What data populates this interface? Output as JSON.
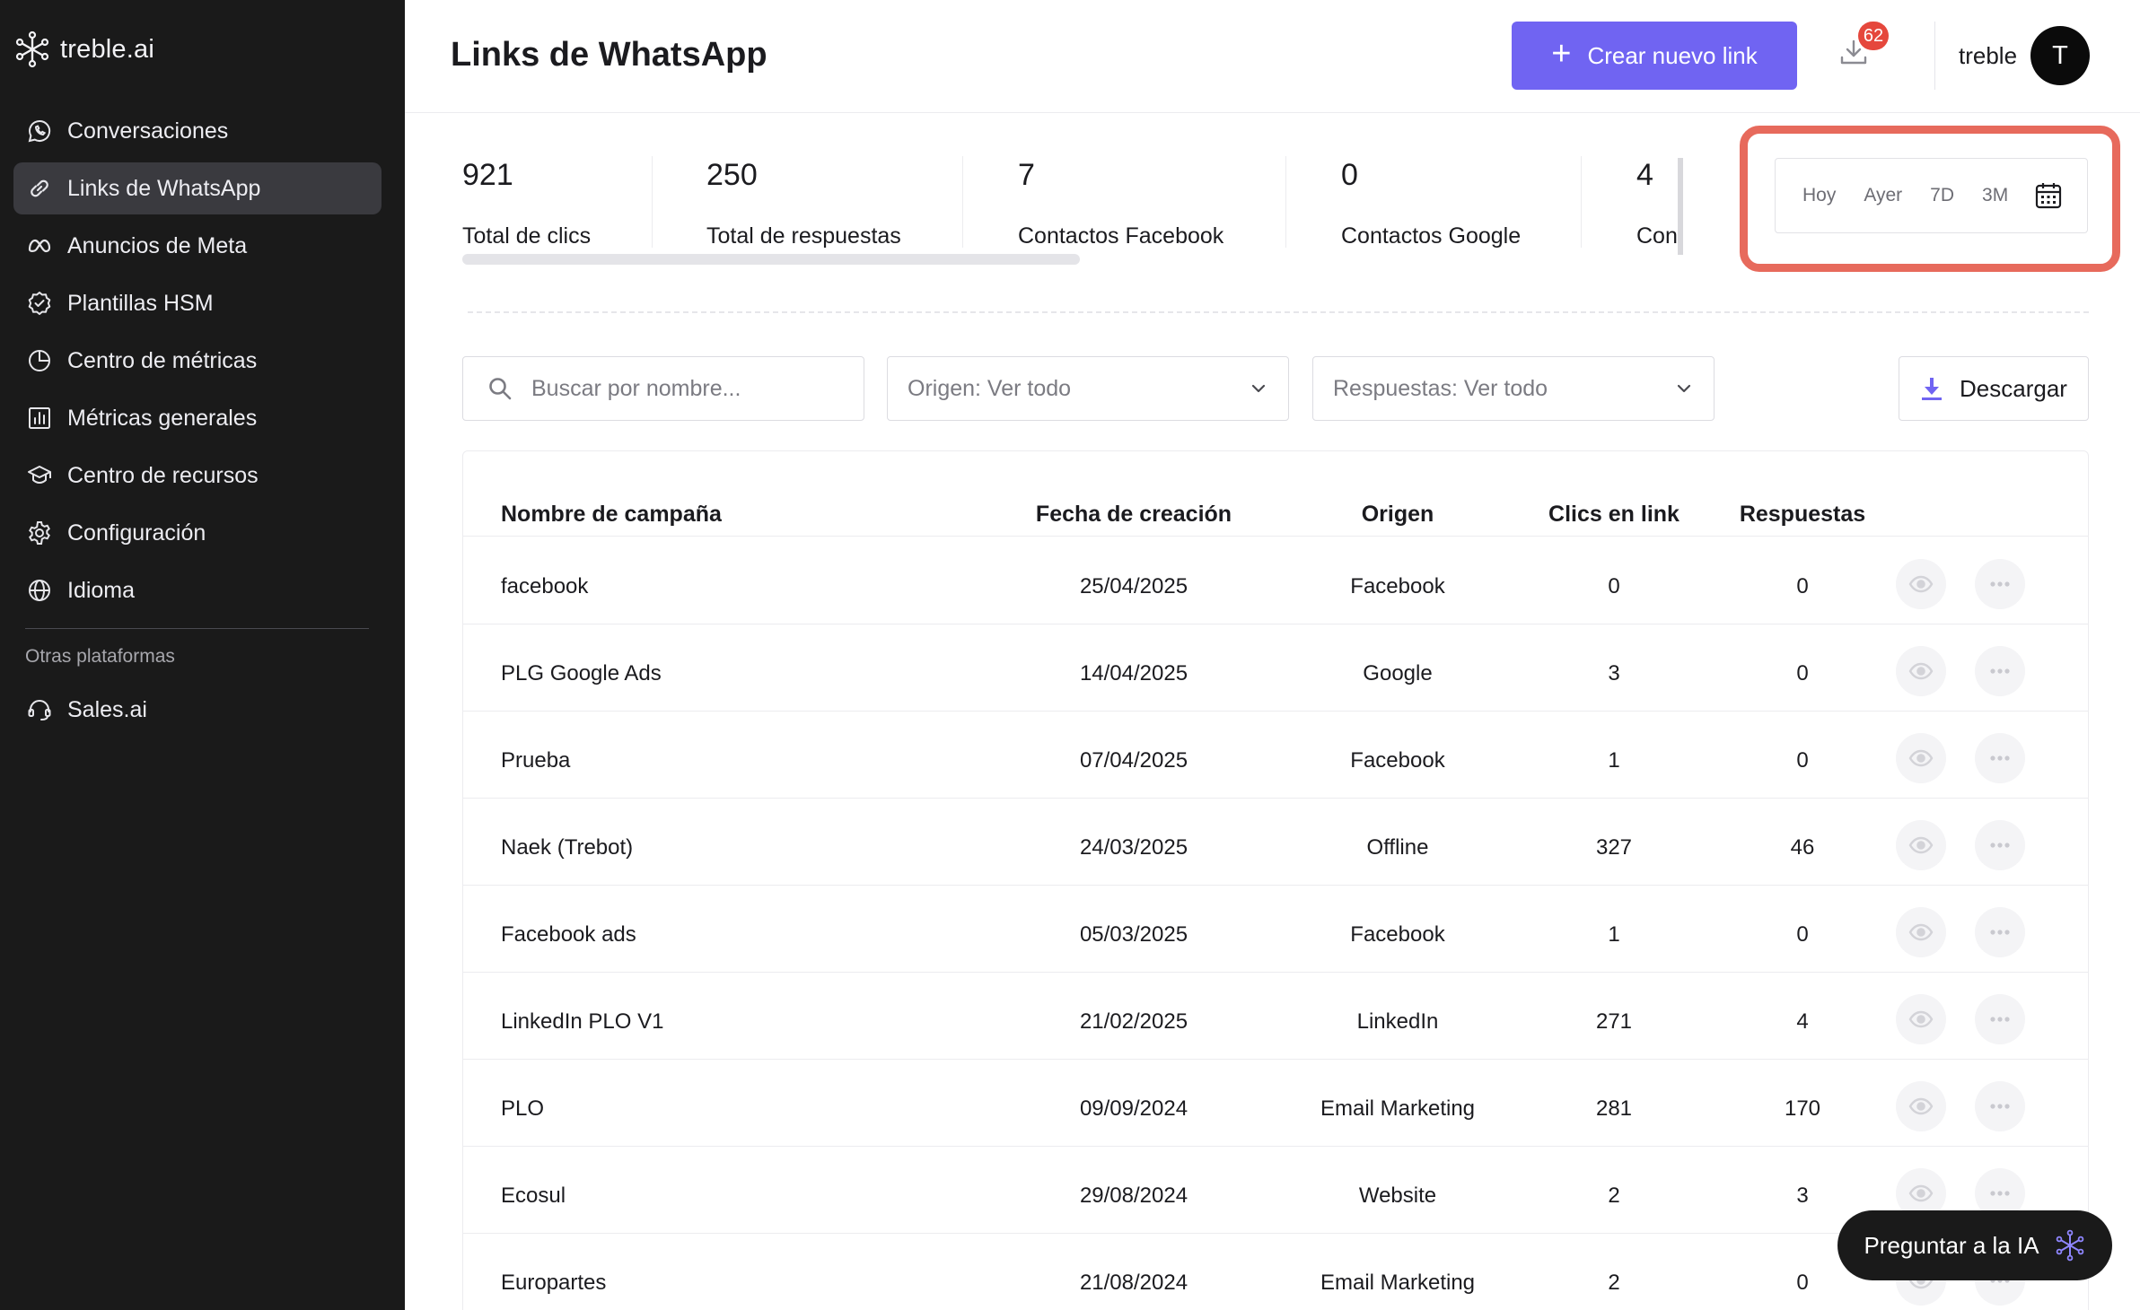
{
  "brand": {
    "name": "treble.ai"
  },
  "sidebar": {
    "items": [
      {
        "label": "Conversaciones",
        "icon": "whatsapp-icon",
        "active": false
      },
      {
        "label": "Links de WhatsApp",
        "icon": "link-icon",
        "active": true
      },
      {
        "label": "Anuncios de Meta",
        "icon": "meta-icon",
        "active": false
      },
      {
        "label": "Plantillas HSM",
        "icon": "badge-check-icon",
        "active": false
      },
      {
        "label": "Centro de métricas",
        "icon": "pie-chart-icon",
        "active": false
      },
      {
        "label": "Métricas generales",
        "icon": "bar-chart-icon",
        "active": false
      },
      {
        "label": "Centro de recursos",
        "icon": "graduation-cap-icon",
        "active": false
      },
      {
        "label": "Configuración",
        "icon": "gear-icon",
        "active": false
      },
      {
        "label": "Idioma",
        "icon": "globe-icon",
        "active": false
      }
    ],
    "section_label": "Otras plataformas",
    "extra_items": [
      {
        "label": "Sales.ai",
        "icon": "headset-icon"
      }
    ]
  },
  "header": {
    "title": "Links de WhatsApp",
    "create_button": "Crear nuevo link",
    "notifications_count": "62",
    "user_name": "treble",
    "avatar_initial": "T"
  },
  "kpis": [
    {
      "value": "921",
      "label": "Total de clics"
    },
    {
      "value": "250",
      "label": "Total de respuestas"
    },
    {
      "value": "7",
      "label": "Contactos Facebook"
    },
    {
      "value": "0",
      "label": "Contactos Google"
    },
    {
      "value": "4",
      "label": "Con"
    }
  ],
  "date_filter": {
    "options": [
      "Hoy",
      "Ayer",
      "7D",
      "3M"
    ],
    "highlight_color": "#e76a5c"
  },
  "filters": {
    "search_placeholder": "Buscar por nombre...",
    "origen": "Origen: Ver todo",
    "respuestas": "Respuestas: Ver todo",
    "download": "Descargar"
  },
  "table": {
    "columns": [
      "Nombre de campaña",
      "Fecha de creación",
      "Origen",
      "Clics en link",
      "Respuestas"
    ],
    "rows": [
      {
        "name": "facebook",
        "date": "25/04/2025",
        "origin": "Facebook",
        "clicks": "0",
        "responses": "0"
      },
      {
        "name": "PLG Google Ads",
        "date": "14/04/2025",
        "origin": "Google",
        "clicks": "3",
        "responses": "0"
      },
      {
        "name": "Prueba",
        "date": "07/04/2025",
        "origin": "Facebook",
        "clicks": "1",
        "responses": "0"
      },
      {
        "name": "Naek (Trebot)",
        "date": "24/03/2025",
        "origin": "Offline",
        "clicks": "327",
        "responses": "46"
      },
      {
        "name": "Facebook ads",
        "date": "05/03/2025",
        "origin": "Facebook",
        "clicks": "1",
        "responses": "0"
      },
      {
        "name": "LinkedIn PLO V1",
        "date": "21/02/2025",
        "origin": "LinkedIn",
        "clicks": "271",
        "responses": "4"
      },
      {
        "name": "PLO",
        "date": "09/09/2024",
        "origin": "Email Marketing",
        "clicks": "281",
        "responses": "170"
      },
      {
        "name": "Ecosul",
        "date": "29/08/2024",
        "origin": "Website",
        "clicks": "2",
        "responses": "3"
      },
      {
        "name": "Europartes",
        "date": "21/08/2024",
        "origin": "Email Marketing",
        "clicks": "2",
        "responses": "0"
      }
    ]
  },
  "ask_ai": {
    "label": "Preguntar a la IA"
  },
  "colors": {
    "accent": "#7064f2",
    "sidebar_bg": "#1a1a1a",
    "badge": "#e5473c"
  }
}
